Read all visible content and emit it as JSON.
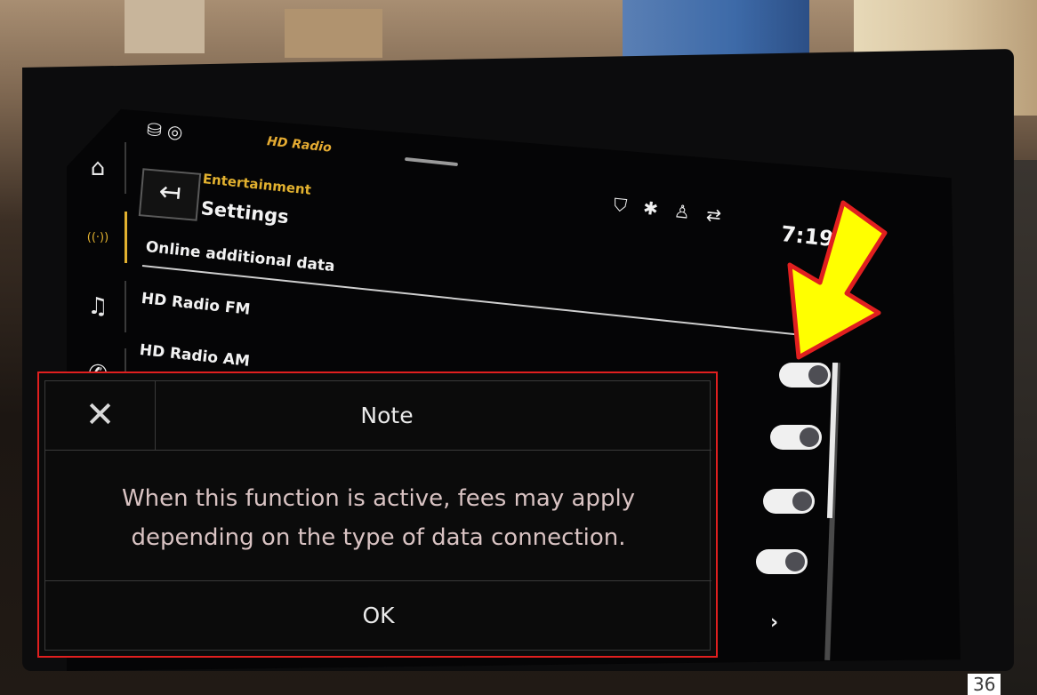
{
  "header": {
    "breadcrumb": "Entertainment",
    "title": "Settings",
    "time": "7:19",
    "radio_logo": "HD Radio"
  },
  "status_icons": [
    "connected-services-icon",
    "bluetooth-icon",
    "user-profile-icon",
    "data-transfer-icon"
  ],
  "nav": {
    "items": [
      {
        "icon": "home-icon",
        "glyph": "⌂"
      },
      {
        "icon": "radio-icon",
        "glyph": "((·))",
        "active": true
      },
      {
        "icon": "music-icon",
        "glyph": "♫"
      },
      {
        "icon": "phone-icon",
        "glyph": "✆"
      }
    ]
  },
  "settings_list": {
    "items": [
      {
        "label": "Online additional data"
      },
      {
        "label": "HD Radio FM"
      },
      {
        "label": "HD Radio AM"
      }
    ],
    "toggles": [
      true,
      true,
      true,
      true
    ]
  },
  "dialog": {
    "close_glyph": "✕",
    "title": "Note",
    "message_line1": "When this function is active, fees may apply",
    "message_line2": "depending on the type of data connection.",
    "ok_label": "OK"
  },
  "annotation": {
    "arrow_color": "#ffff00",
    "arrow_outline": "#e01f1f",
    "highlight_color": "#e01f1f"
  },
  "page_number": "36"
}
